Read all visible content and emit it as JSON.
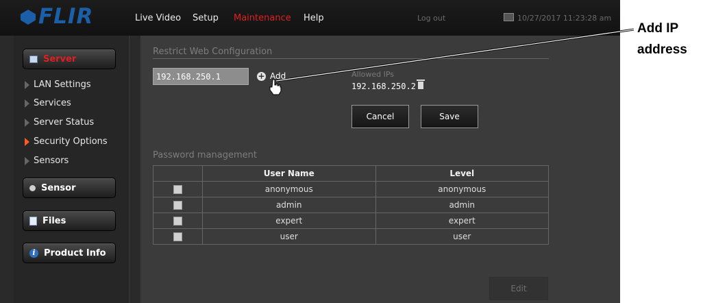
{
  "topbar": {
    "logo": "FLIR",
    "nav": [
      "Live Video",
      "Setup",
      "Maintenance",
      "Help"
    ],
    "logout": "Log out",
    "datetime": "10/27/2017 11:23:28 am"
  },
  "sidebar": {
    "server_label": "Server",
    "items": [
      "LAN Settings",
      "Services",
      "Server Status",
      "Security Options",
      "Sensors"
    ],
    "active_item": "Security Options",
    "sensor_label": "Sensor",
    "files_label": "Files",
    "product_info_label": "Product Info"
  },
  "restrict": {
    "title": "Restrict Web Configuration",
    "ip_value": "192.168.250.1",
    "add_label": "Add",
    "allowed_label": "Allowed IPs",
    "allowed_ip": "192.168.250.2",
    "cancel_label": "Cancel",
    "save_label": "Save"
  },
  "password": {
    "title": "Password management",
    "headers": [
      "User Name",
      "Level"
    ],
    "rows": [
      {
        "user": "anonymous",
        "level": "anonymous"
      },
      {
        "user": "admin",
        "level": "admin"
      },
      {
        "user": "expert",
        "level": "expert"
      },
      {
        "user": "user",
        "level": "user"
      }
    ],
    "edit_label": "Edit"
  },
  "callout": {
    "text": "Add IP\naddress"
  },
  "colors": {
    "accent_red": "#e02020",
    "logo_blue": "#1b5fa8",
    "active_arrow": "#ff5a1f"
  }
}
